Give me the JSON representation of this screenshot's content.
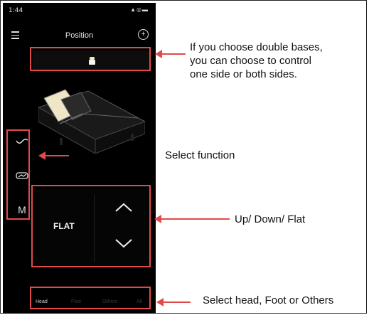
{
  "status_bar": {
    "time": "1:44",
    "icons": "▲◎▬"
  },
  "header": {
    "title": "Position"
  },
  "side_functions": [
    {
      "icon": "massage-wave-icon"
    },
    {
      "icon": "zero-gravity-icon"
    },
    {
      "label": "M"
    }
  ],
  "controls": {
    "flat_label": "FLAT"
  },
  "bottom_tabs": [
    {
      "label": "Head",
      "active": true
    },
    {
      "label": "Foot",
      "active": false
    },
    {
      "label": "Others",
      "active": false
    },
    {
      "label": "All",
      "active": false
    }
  ],
  "annotations": {
    "base_note": "If you choose double bases,\nyou can choose to control\none side or both sides.",
    "function_note": "Select function",
    "updown_note": "Up/ Down/ Flat",
    "tabs_note": "Select head, Foot or Others"
  },
  "colors": {
    "annotation": "#e04a4a",
    "screen": "#000000"
  }
}
